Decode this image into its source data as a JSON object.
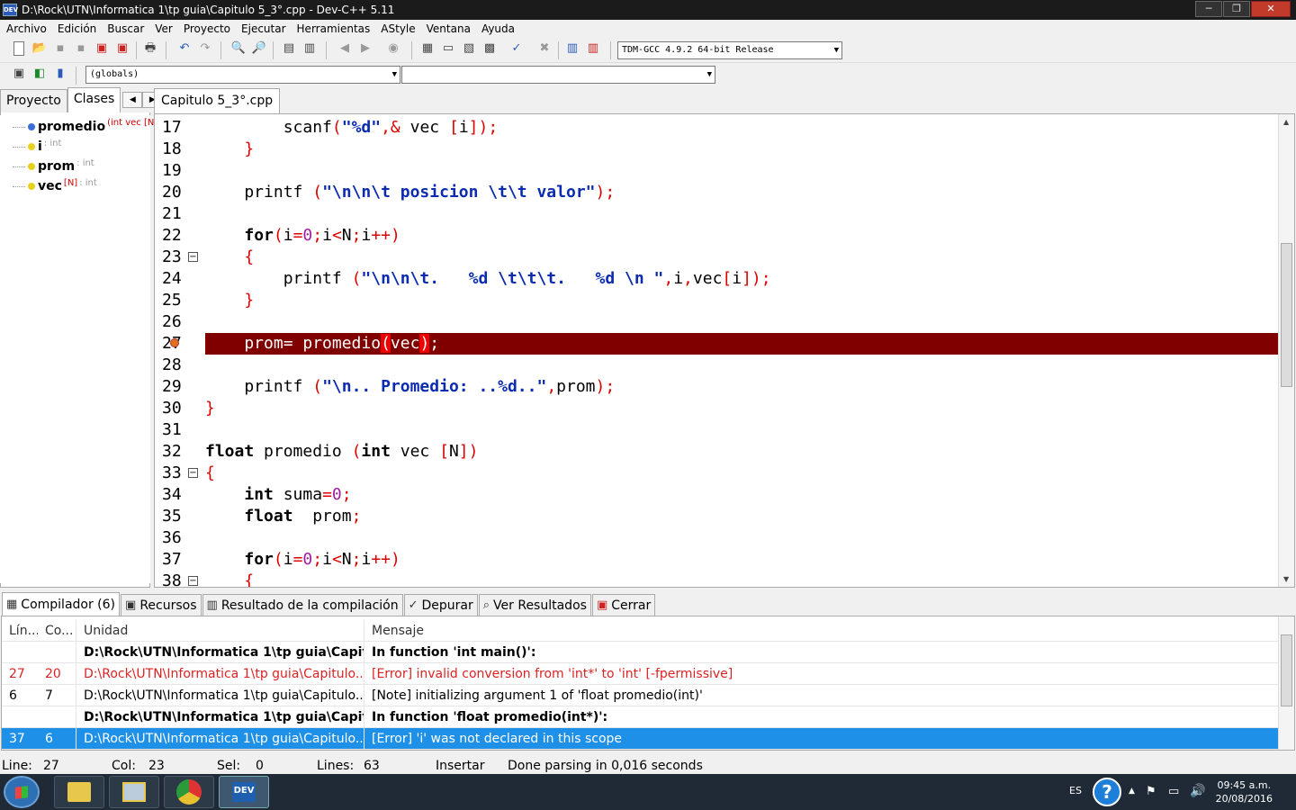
{
  "window": {
    "title": "D:\\Rock\\UTN\\Informatica 1\\tp guia\\Capitulo 5_3°.cpp - Dev-C++ 5.11",
    "app_icon": "DEV",
    "controls": [
      "─",
      "❐",
      "✕"
    ]
  },
  "menu": [
    "Archivo",
    "Edición",
    "Buscar",
    "Ver",
    "Proyecto",
    "Ejecutar",
    "Herramientas",
    "AStyle",
    "Ventana",
    "Ayuda"
  ],
  "compiler": {
    "selected": "TDM-GCC 4.9.2 64-bit Release"
  },
  "scope": {
    "selected": "(globals)",
    "second": ""
  },
  "left_panel": {
    "tabs": [
      "Proyecto",
      "Clases"
    ],
    "active": "Clases",
    "items": [
      {
        "name": "promedio",
        "detail": "(int vec [N",
        "icon": "function-icon",
        "color": "#3a6fd8"
      },
      {
        "name": "i",
        "detail": ": int",
        "icon": "variable-icon",
        "color": "#e8d020"
      },
      {
        "name": "prom",
        "detail": ": int",
        "icon": "variable-icon",
        "color": "#e8d020"
      },
      {
        "name": "vec",
        "detail": "[N]",
        "detail2": ": int",
        "icon": "variable-icon",
        "color": "#e8d020"
      }
    ]
  },
  "editor": {
    "tab": "Capitulo 5_3°.cpp",
    "lines": [
      {
        "n": "17",
        "html": "<span class='pad'>        </span>scanf<span class='op'>(</span><span class='st'>\"%d\"</span><span class='op'>,&amp;</span> vec <span class='op'>[</span>i<span class='op'>]);</span>"
      },
      {
        "n": "18",
        "html": "    <span class='op'>}</span>"
      },
      {
        "n": "19",
        "html": ""
      },
      {
        "n": "20",
        "html": "    printf <span class='op'>(</span><span class='st'>\"\\n\\n\\t posicion \\t\\t valor\"</span><span class='op'>);</span>"
      },
      {
        "n": "21",
        "html": ""
      },
      {
        "n": "22",
        "html": "    <span class='kw'>for</span><span class='op'>(</span>i<span class='op'>=</span><span class='num'>0</span><span class='op'>;</span>i<span class='op'>&lt;</span>N<span class='op'>;</span>i<span class='op'>++)</span>"
      },
      {
        "n": "23",
        "html": "    <span class='op'>{</span>",
        "fold": "−"
      },
      {
        "n": "24",
        "html": "        printf <span class='op'>(</span><span class='st'>\"\\n\\n\\t.   %d \\t\\t\\t.   %d \\n \"</span><span class='op'>,</span>i<span class='op'>,</span>vec<span class='op'>[</span>i<span class='op'>]);</span>"
      },
      {
        "n": "25",
        "html": "    <span class='op'>}</span>"
      },
      {
        "n": "26",
        "html": ""
      },
      {
        "n": "27",
        "html": "    prom= promedio<span class='op' style='background:#e00;color:#fff'>(</span>vec<span class='op' style='background:#e00;color:#fff'>)</span>;",
        "hl": true
      },
      {
        "n": "28",
        "html": ""
      },
      {
        "n": "29",
        "html": "    printf <span class='op'>(</span><span class='st'>\"\\n.. Promedio: ..%d..\"</span><span class='op'>,</span>prom<span class='op'>);</span>"
      },
      {
        "n": "30",
        "html": "<span class='op'>}</span>"
      },
      {
        "n": "31",
        "html": ""
      },
      {
        "n": "32",
        "html": "<span class='kw'>float</span> promedio <span class='op'>(</span><span class='kw'>int</span> vec <span class='op'>[</span>N<span class='op'>])</span>"
      },
      {
        "n": "33",
        "html": "<span class='op'>{</span>",
        "fold": "−"
      },
      {
        "n": "34",
        "html": "    <span class='kw'>int</span> suma<span class='op'>=</span><span class='num'>0</span><span class='op'>;</span>"
      },
      {
        "n": "35",
        "html": "    <span class='kw'>float</span>  prom<span class='op'>;</span>"
      },
      {
        "n": "36",
        "html": ""
      },
      {
        "n": "37",
        "html": "    <span class='kw'>for</span><span class='op'>(</span>i<span class='op'>=</span><span class='num'>0</span><span class='op'>;</span>i<span class='op'>&lt;</span>N<span class='op'>;</span>i<span class='op'>++)</span>"
      },
      {
        "n": "38",
        "html": "    <span class='op'>{</span>",
        "fold": "−"
      }
    ]
  },
  "bottom_tabs": [
    {
      "label": "Compilador (6)",
      "icon": "grid-icon"
    },
    {
      "label": "Recursos",
      "icon": "resources-icon"
    },
    {
      "label": "Resultado de la compilación",
      "icon": "chart-icon"
    },
    {
      "label": "Depurar",
      "icon": "check-icon"
    },
    {
      "label": "Ver Resultados",
      "icon": "search-icon"
    },
    {
      "label": "Cerrar",
      "icon": "close-icon"
    }
  ],
  "messages": {
    "headers": [
      "Lín...",
      "Co...",
      "Unidad",
      "Mensaje"
    ],
    "rows": [
      {
        "line": "",
        "col": "",
        "unit": "D:\\Rock\\UTN\\Informatica 1\\tp guia\\Capit...",
        "msg": "In function 'int main()':",
        "style": "bold"
      },
      {
        "line": "27",
        "col": "20",
        "unit": "D:\\Rock\\UTN\\Informatica 1\\tp guia\\Capitulo...",
        "msg": "[Error] invalid conversion from 'int*' to 'int' [-fpermissive]",
        "style": "err"
      },
      {
        "line": "6",
        "col": "7",
        "unit": "D:\\Rock\\UTN\\Informatica 1\\tp guia\\Capitulo...",
        "msg": "[Note] initializing argument 1 of 'float promedio(int)'",
        "style": ""
      },
      {
        "line": "",
        "col": "",
        "unit": "D:\\Rock\\UTN\\Informatica 1\\tp guia\\Capit...",
        "msg": "In function 'float promedio(int*)':",
        "style": "bold"
      },
      {
        "line": "37",
        "col": "6",
        "unit": "D:\\Rock\\UTN\\Informatica 1\\tp guia\\Capitulo...",
        "msg": "[Error] 'i' was not declared in this scope",
        "style": "sel"
      }
    ]
  },
  "status": {
    "line_label": "Line:",
    "line": "27",
    "col_label": "Col:",
    "col": "23",
    "sel_label": "Sel:",
    "sel": "0",
    "lines_label": "Lines:",
    "lines": "63",
    "mode": "Insertar",
    "parse": "Done parsing in 0,016 seconds"
  },
  "taskbar": {
    "lang": "ES",
    "time": "09:45 a.m.",
    "date": "20/08/2016",
    "devcpp_label": "DEV"
  }
}
